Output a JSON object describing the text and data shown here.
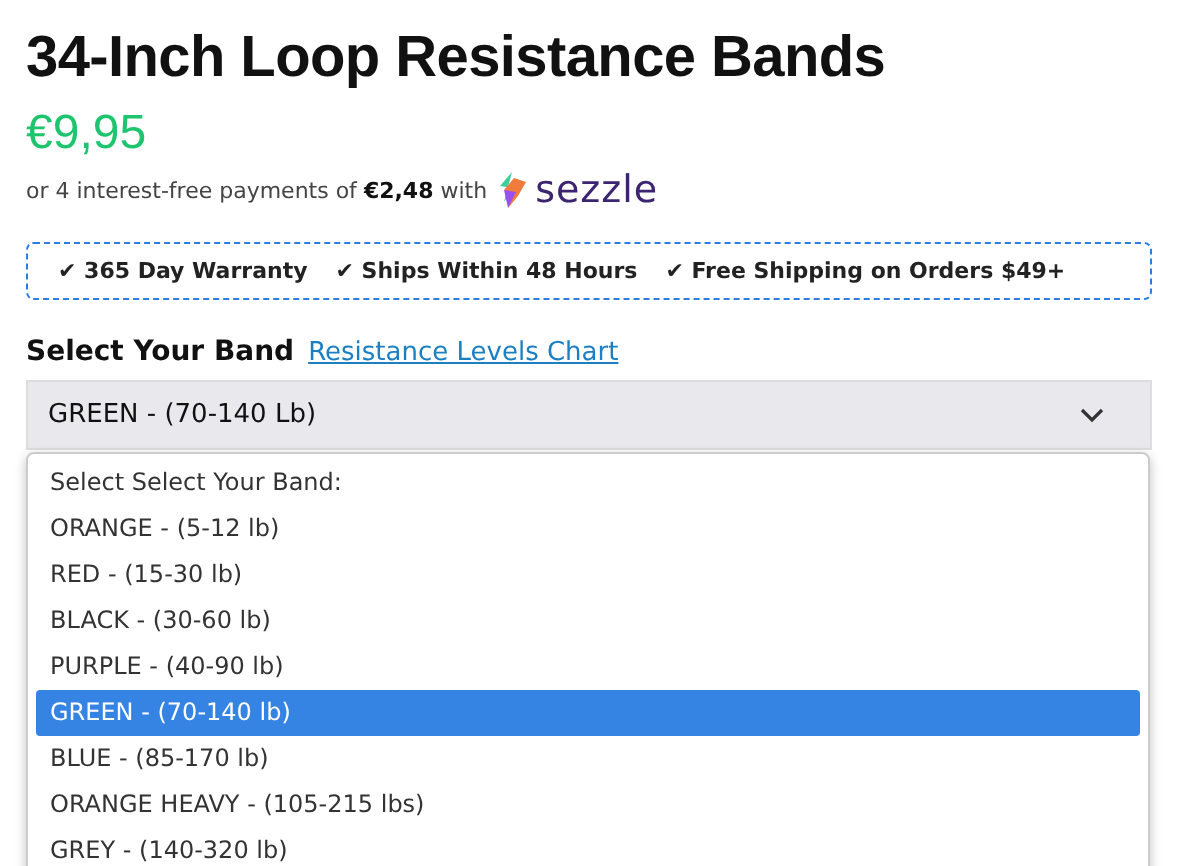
{
  "title": "34-Inch Loop Resistance Bands",
  "price": "€9,95",
  "installments": {
    "text": "or 4 interest-free payments of **€2,48** with",
    "brand": "sezzle"
  },
  "features": [
    "✔ 365 Day Warranty",
    "✔ Ships Within 48 Hours",
    "✔ Free Shipping on Orders $49+"
  ],
  "band_label": "Select Your Band",
  "chart_link": "Resistance Levels Chart",
  "select": {
    "value": "GREEN - (70-140 Lb)"
  },
  "options": [
    {
      "label": "Select Select Your Band:",
      "selected": false
    },
    {
      "label": "ORANGE - (5-12 lb)",
      "selected": false
    },
    {
      "label": "RED - (15-30 lb)",
      "selected": false
    },
    {
      "label": "BLACK - (30-60 lb)",
      "selected": false
    },
    {
      "label": "PURPLE - (40-90 lb)",
      "selected": false
    },
    {
      "label": "GREEN - (70-140 lb)",
      "selected": true
    },
    {
      "label": "BLUE - (85-170 lb)",
      "selected": false
    },
    {
      "label": "ORANGE HEAVY - (105-215 lbs)",
      "selected": false
    },
    {
      "label": "GREY - (140-320 lb)",
      "selected": false
    }
  ]
}
